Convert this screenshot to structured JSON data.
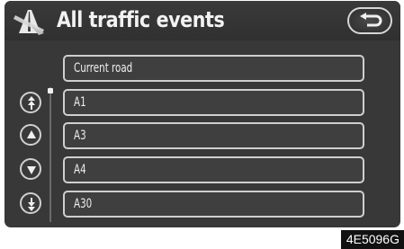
{
  "header": {
    "title": "All traffic events",
    "title_icon": "traffic-events-icon",
    "back_icon": "back-arrow-icon"
  },
  "list": {
    "items": [
      {
        "label": "Current road"
      },
      {
        "label": "A1"
      },
      {
        "label": "A3"
      },
      {
        "label": "A4"
      },
      {
        "label": "A30"
      }
    ]
  },
  "scroll_controls": {
    "icons": [
      "page-up-icon",
      "line-up-icon",
      "line-down-icon",
      "page-down-icon"
    ]
  },
  "figure_code": "4E5096G",
  "colors": {
    "screen_bg": "#383838",
    "border": "#cfcfcf",
    "text": "#efefef"
  }
}
